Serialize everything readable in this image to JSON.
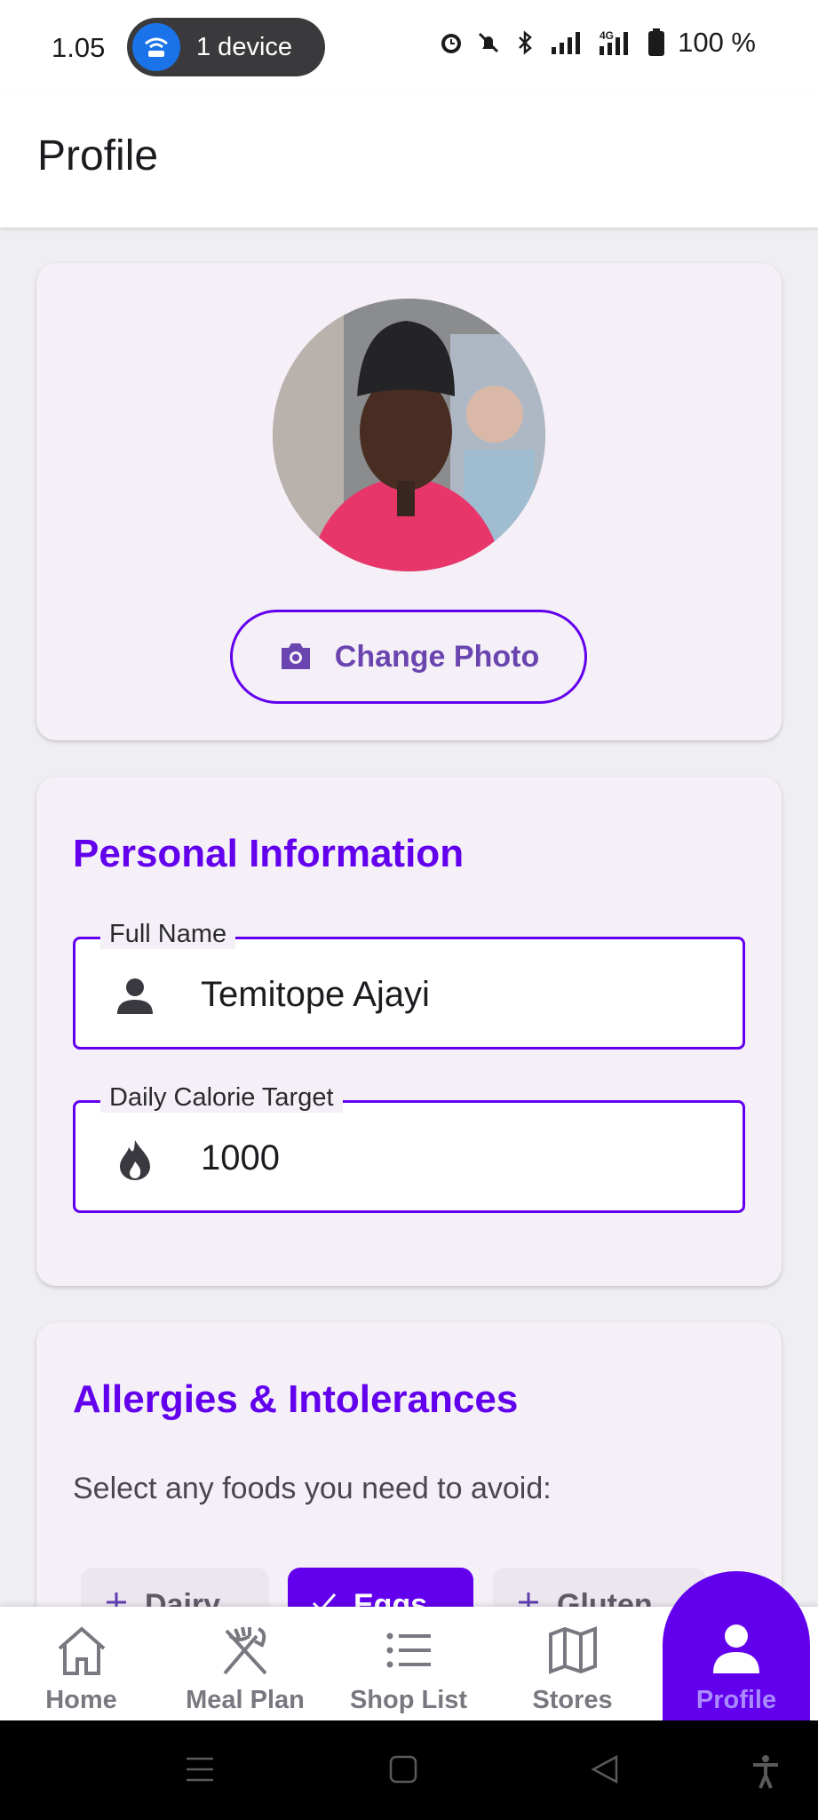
{
  "status_bar": {
    "time": "1.05",
    "device_pill": "1 device",
    "battery": "100 %"
  },
  "app_bar": {
    "title": "Profile"
  },
  "photo_card": {
    "change_photo_label": "Change Photo"
  },
  "personal_info": {
    "title": "Personal Information",
    "full_name": {
      "label": "Full Name",
      "value": "Temitope Ajayi",
      "icon": "person-icon"
    },
    "calorie_target": {
      "label": "Daily Calorie Target",
      "value": "1000",
      "icon": "flame-icon"
    }
  },
  "allergies": {
    "title": "Allergies & Intolerances",
    "description": "Select any foods you need to avoid:",
    "chips": [
      {
        "label": "Dairy",
        "selected": false
      },
      {
        "label": "Eggs",
        "selected": true
      },
      {
        "label": "Gluten",
        "selected": false
      }
    ]
  },
  "bottom_nav": {
    "items": [
      {
        "label": "Home",
        "icon": "home-icon"
      },
      {
        "label": "Meal Plan",
        "icon": "utensils-icon"
      },
      {
        "label": "Shop List",
        "icon": "list-icon"
      },
      {
        "label": "Stores",
        "icon": "map-icon"
      },
      {
        "label": "Profile",
        "icon": "person-icon",
        "active": true
      }
    ]
  },
  "colors": {
    "accent": "#6200ee",
    "card_bg": "#f5eff7",
    "page_bg": "#efeef1"
  }
}
